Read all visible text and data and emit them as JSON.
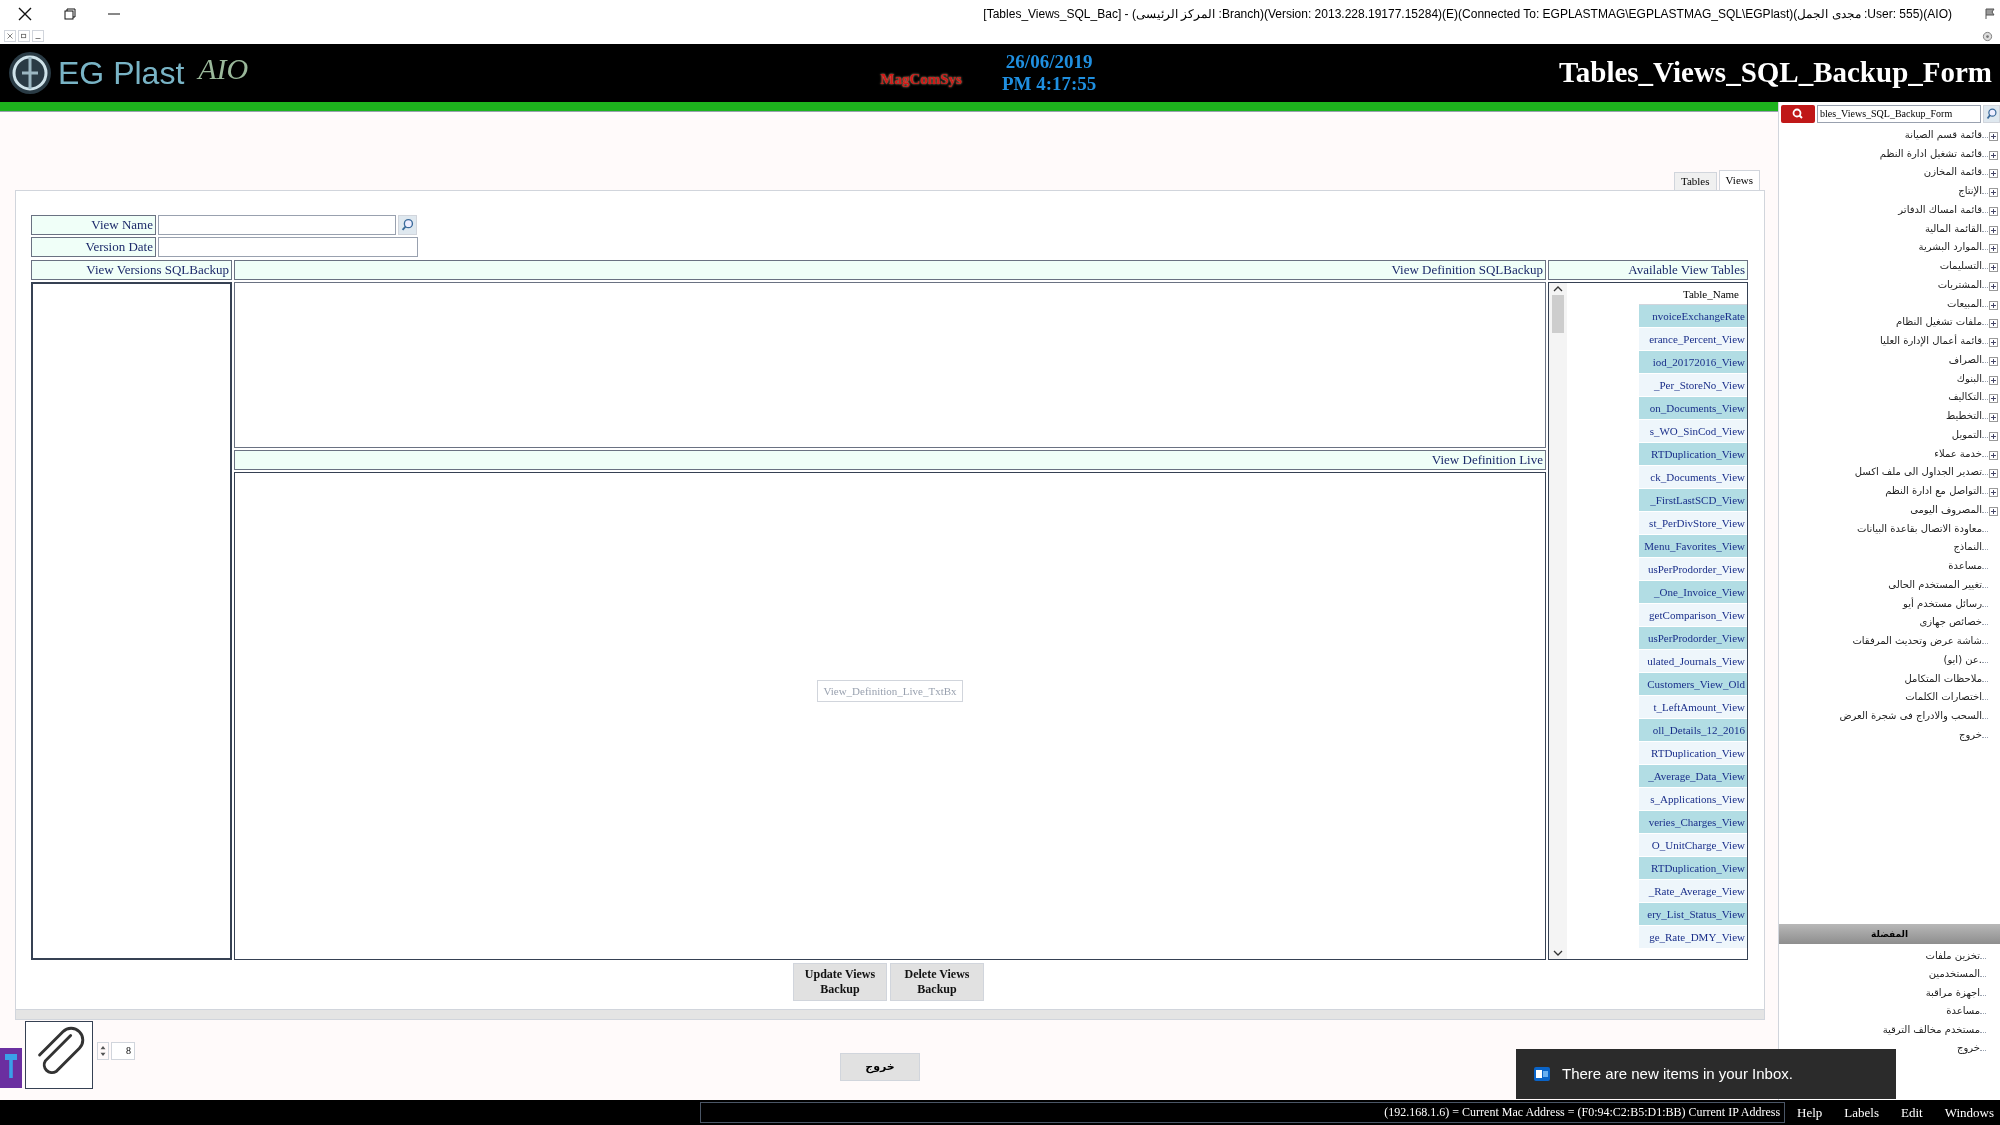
{
  "window": {
    "title": "[Tables_Views_SQL_Bac] - (المركز الرئيسى :Branch)(Version: 2013.228.19177.15284)(E)(Connected To: EGPLASTMAG\\EGPLASTMAG_SQL\\EGPlast)(مجدى الجمل :User: 555)(AIO)"
  },
  "header": {
    "app_name": "EG Plast",
    "edition": "AIO",
    "vendor": "MagComSys",
    "date": "26/06/2019",
    "time": "PM 4:17:55",
    "form_title": "Tables_Views_SQL_Backup_Form"
  },
  "tabs": [
    {
      "label": "Views",
      "selected": true
    },
    {
      "label": "Tables",
      "selected": false
    }
  ],
  "fields": [
    {
      "label": "View Name",
      "has_search": true
    },
    {
      "label": "Version Date",
      "has_search": false
    }
  ],
  "sections": {
    "versions": "View Versions SQLBackup",
    "definition_backup": "View Definition SQLBackup",
    "definition_live": "View Definition Live",
    "available": "Available View Tables"
  },
  "live_placeholder": "View_Definition_Live_TxtBx",
  "table": {
    "columns": [
      "Table_Name"
    ],
    "rows": [
      "nvoiceExchangeRate",
      "erance_Percent_View",
      "iod_20172016_View",
      "_Per_StoreNo_View",
      "on_Documents_View",
      "s_WO_SinCod_View",
      "RTDuplication_View",
      "ck_Documents_View",
      "_FirstLastSCD_View",
      "st_PerDivStore_View",
      "Menu_Favorites_View",
      "usPerProdorder_View",
      "_One_Invoice_View",
      "getComparison_View",
      "usPerProdorder_View",
      "ulated_Journals_View",
      "Customers_View_Old",
      "t_LeftAmount_View",
      "oll_Details_12_2016",
      "RTDuplication_View",
      "_Average_Data_View",
      "s_Applications_View",
      "veries_Charges_View",
      "O_UnitCharge_View",
      "RTDuplication_View",
      "_Rate_Average_View",
      "ery_List_Status_View",
      "ge_Rate_DMY_View"
    ]
  },
  "buttons": [
    "Delete Views Backup",
    "Update Views Backup"
  ],
  "spinner": {
    "value": "8"
  },
  "exit_button": "خروج",
  "sidebar": {
    "search": {
      "value": "bles_Views_SQL_Backup_Form"
    },
    "tree": [
      {
        "label": "قائمة قسم الصيانة",
        "expandable": true
      },
      {
        "label": "قائمة تشغيل ادارة النظم",
        "expandable": true
      },
      {
        "label": "قائمة المخازن",
        "expandable": true
      },
      {
        "label": "الإنتاج",
        "expandable": true
      },
      {
        "label": "قائمة امساك الدفاتر",
        "expandable": true
      },
      {
        "label": "القائمة المالية",
        "expandable": true
      },
      {
        "label": "الموارد البشرية",
        "expandable": true
      },
      {
        "label": "التسليمات",
        "expandable": true
      },
      {
        "label": "المشتريات",
        "expandable": true
      },
      {
        "label": "المبيعات",
        "expandable": true
      },
      {
        "label": "ملفات تشغيل النظام",
        "expandable": true
      },
      {
        "label": "قائمة أعمال الإدارة العليا",
        "expandable": true
      },
      {
        "label": "الصراف",
        "expandable": true
      },
      {
        "label": "البنوك",
        "expandable": true
      },
      {
        "label": "التكاليف",
        "expandable": true
      },
      {
        "label": "التخطيط",
        "expandable": true
      },
      {
        "label": "التمويل",
        "expandable": true
      },
      {
        "label": "خدمة عملاء",
        "expandable": true
      },
      {
        "label": "تصدير الجداول الى ملف اكسل",
        "expandable": true
      },
      {
        "label": "التواصل مع ادارة النظم",
        "expandable": true
      },
      {
        "label": "المصروف اليومى",
        "expandable": true
      },
      {
        "label": "معاودة الاتصال بقاعدة البيانات",
        "expandable": false
      },
      {
        "label": "النماذج",
        "expandable": false
      },
      {
        "label": "مساعدة",
        "expandable": false
      },
      {
        "label": "تغيير المستخدم الحالى",
        "expandable": false
      },
      {
        "label": "رسائل مستخدم أيو",
        "expandable": false
      },
      {
        "label": "خصائص جهازى",
        "expandable": false
      },
      {
        "label": "شاشة عرض وتحديث المرفقات",
        "expandable": false
      },
      {
        "label": "عن (ايو).",
        "expandable": false
      },
      {
        "label": "ملاحظات المتكامل",
        "expandable": false
      },
      {
        "label": "اختصارات الكلمات",
        "expandable": false
      },
      {
        "label": "السحب والادراج فى شجرة العرض",
        "expandable": false
      },
      {
        "label": "خروج",
        "expandable": false
      }
    ],
    "favorites_title": "المفضلة",
    "favorites": [
      "تخزين ملفات",
      "المستخدمين",
      "اجهزة مراقبة",
      "مساعدة",
      "مستخدم مخالف الترقية",
      "خروج"
    ]
  },
  "status_bar": {
    "text": "(192.168.1.6) = Current Mac Address = (F0:94:C2:B5:D1:BB) Current IP Address",
    "menus": [
      "Windows",
      "Edit",
      "Labels",
      "Help"
    ]
  },
  "notification": {
    "text": "There are new items in your Inbox."
  }
}
